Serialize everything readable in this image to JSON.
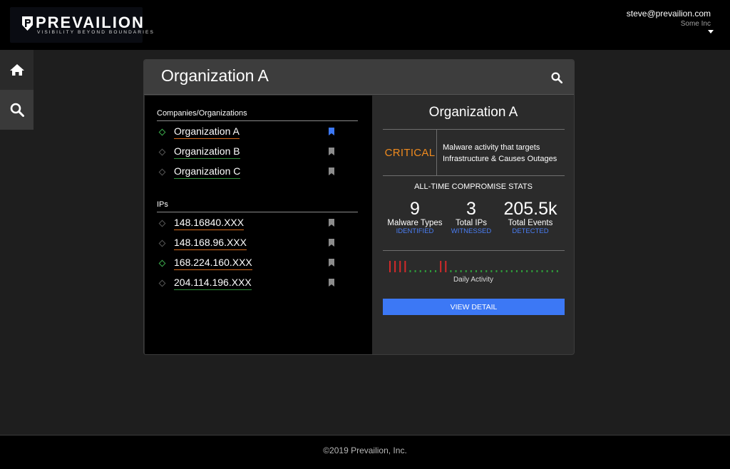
{
  "brand": {
    "name": "PREVAILION",
    "tagline": "VISIBILITY BEYOND BOUNDARIES"
  },
  "user": {
    "email": "steve@prevailion.com",
    "org": "Some Inc"
  },
  "sidebar": [
    {
      "icon": "home-icon"
    },
    {
      "icon": "search-icon"
    }
  ],
  "card": {
    "title": "Organization A"
  },
  "companies": {
    "heading": "Companies/Organizations",
    "items": [
      {
        "label": "Organization A",
        "status": "ok",
        "bookmarked": true
      },
      {
        "label": "Organization B",
        "status": "none",
        "bookmarked": false
      },
      {
        "label": "Organization C",
        "status": "none",
        "bookmarked": false
      }
    ]
  },
  "ips": {
    "heading": "IPs",
    "items": [
      {
        "label": "148.16840.XXX",
        "status": "none",
        "bookmarked": false
      },
      {
        "label": "148.168.96.XXX",
        "status": "none",
        "bookmarked": false
      },
      {
        "label": "168.224.160.XXX",
        "status": "ok",
        "bookmarked": false
      },
      {
        "label": "204.114.196.XXX",
        "status": "none",
        "bookmarked": false
      }
    ]
  },
  "detail": {
    "title": "Organization A",
    "severity": "CRITICAL",
    "severity_desc_line1": "Malware activity that targets",
    "severity_desc_line2": "Infrastructure & Causes Outages",
    "stats_title": "ALL-TIME COMPROMISE STATS",
    "stats": [
      {
        "value": "9",
        "label": "Malware Types",
        "sub": "IDENTIFIED"
      },
      {
        "value": "3",
        "label": "Total IPs",
        "sub": "WITNESSED"
      },
      {
        "value": "205.5k",
        "label": "Total Events",
        "sub": "DETECTED"
      }
    ],
    "activity": [
      "high",
      "high",
      "high",
      "high",
      "low",
      "low",
      "low",
      "low",
      "low",
      "low",
      "high",
      "high",
      "low",
      "low",
      "low",
      "low",
      "low",
      "low",
      "low",
      "low",
      "low",
      "low",
      "low",
      "low",
      "low",
      "low",
      "low",
      "low",
      "low",
      "low",
      "low",
      "low",
      "low",
      "low"
    ],
    "activity_label": "Daily Activity",
    "button": "VIEW DETAIL"
  },
  "footer": "©2019 Prevailion, Inc.",
  "colors": {
    "accent": "#3c78f5",
    "critical": "#ef8a1e",
    "activity_high": "#d42a2a",
    "activity_low": "#2f9a3a"
  }
}
